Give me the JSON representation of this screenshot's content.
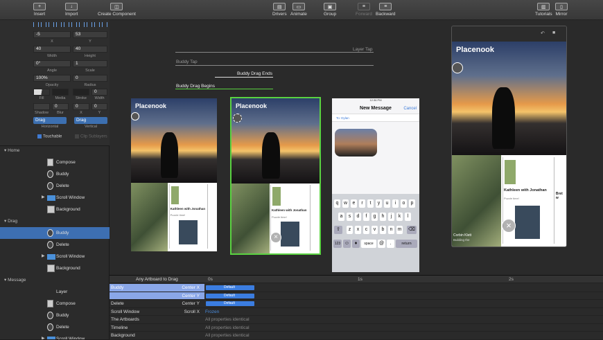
{
  "toolbar": {
    "insert": "Insert",
    "import": "Import",
    "create_component": "Create Component",
    "drivers": "Drivers",
    "animate": "Animate",
    "group": "Group",
    "forward": "Forward",
    "backward": "Backward",
    "tutorials": "Tutorials",
    "mirror": "Mirror"
  },
  "props": {
    "x": "-5",
    "y": "53",
    "x_label": "X",
    "y_label": "Y",
    "width": "40",
    "height": "40",
    "width_label": "Width",
    "height_label": "Height",
    "angle": "0°",
    "scale": "1",
    "angle_label": "Angle",
    "scale_label": "Scale",
    "opacity": "100%",
    "radius": "0",
    "opacity_label": "Opacity",
    "radius_label": "Radius",
    "fill_label": "Fill",
    "media_label": "Media",
    "stroke_label": "Stroke",
    "stroke_width": "0",
    "stroke_width_label": "Width",
    "shadow_label": "Shadow",
    "blur": "0",
    "blur_label": "Blur",
    "sx": "0",
    "sy": "0",
    "sx_label": "X",
    "sy_label": "Y",
    "horizontal": "Drag",
    "vertical": "Drag",
    "horizontal_label": "Horizontal",
    "vertical_label": "Vertical",
    "touchable": "Touchable",
    "clip": "Clip Sublayers"
  },
  "layers": {
    "home": {
      "title": "Home",
      "items": [
        "Compose",
        "Buddy",
        "Delete",
        "Scroll Window",
        "Background"
      ]
    },
    "drag": {
      "title": "Drag",
      "items": [
        "Buddy",
        "Delete",
        "Scroll Window",
        "Background"
      ]
    },
    "message": {
      "title": "Message",
      "items": [
        "Layer",
        "Compose",
        "Buddy",
        "Delete",
        "Scroll Window"
      ]
    }
  },
  "canvas": {
    "layer_tap": "Layer Tap",
    "buddy_tap": "Buddy Tap",
    "buddy_drag_ends": "Buddy Drag Ends",
    "buddy_drag_begins": "Buddy Drag Begins",
    "app_title": "Placenook",
    "card_name": "Kathleen with Jonathan",
    "card_sub": "Puzzle time!",
    "card2_name": "Bret w",
    "card_caption": "Corbin Klett",
    "card_caption2": "Building the",
    "msg_time": "12:36 PM",
    "msg_title": "New Message",
    "msg_cancel": "Cancel",
    "msg_to": "To: Dylan",
    "kb_row1": [
      "q",
      "w",
      "e",
      "r",
      "t",
      "y",
      "u",
      "i",
      "o",
      "p"
    ],
    "kb_row2": [
      "a",
      "s",
      "d",
      "f",
      "g",
      "h",
      "j",
      "k",
      "l"
    ],
    "kb_row3": [
      "z",
      "x",
      "c",
      "v",
      "b",
      "n",
      "m"
    ],
    "kb_123": "123",
    "kb_space": "space",
    "kb_at": "@",
    "kb_dot": ".",
    "kb_return": "return"
  },
  "timeline": {
    "header": "Any Artboard to Drag",
    "t0": "0s",
    "t1": "1s",
    "t2": "2s",
    "rows": [
      {
        "name": "Buddy",
        "prop": "Center X",
        "val": "Default"
      },
      {
        "name": "",
        "prop": "Center Y",
        "val": "Default"
      },
      {
        "name": "Delete",
        "prop": "Center Y",
        "val": "Default"
      },
      {
        "name": "Scroll Window",
        "prop": "Scroll X",
        "val": "Frozen"
      },
      {
        "name": "The Artboards",
        "prop": "",
        "val": "All properties identical"
      },
      {
        "name": "Timeline",
        "prop": "",
        "val": "All properties identical"
      },
      {
        "name": "Background",
        "prop": "",
        "val": "All properties identical"
      }
    ]
  }
}
